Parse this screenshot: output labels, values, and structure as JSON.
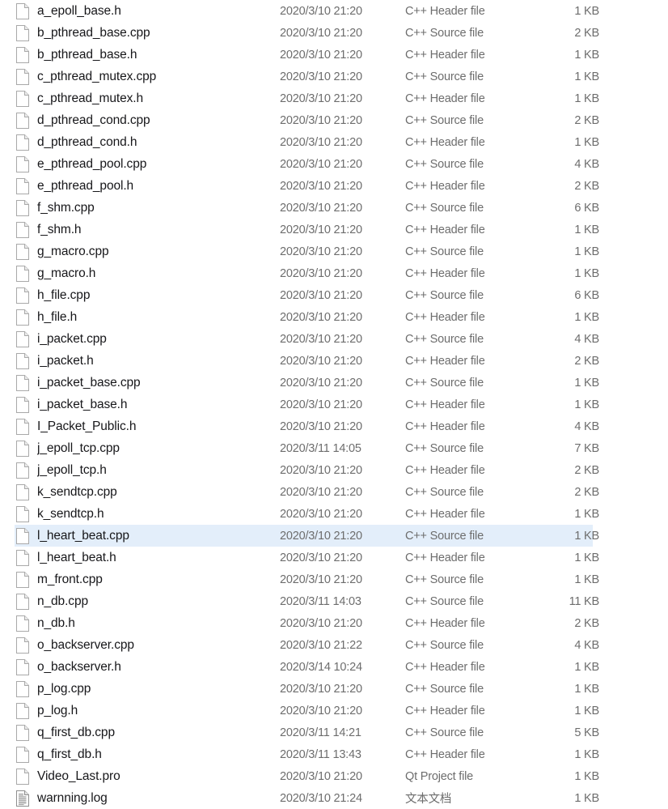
{
  "view": {
    "kind": "file-explorer-list",
    "columns": [
      "Name",
      "Date modified",
      "Type",
      "Size"
    ],
    "selection_color": "#e3eefa",
    "name_color": "#17171a",
    "meta_color": "#6d6d6d"
  },
  "files": [
    {
      "icon": "blank-file-icon",
      "name": "a_epoll_base.h",
      "date": "2020/3/10 21:20",
      "type": "C++ Header file",
      "size": "1 KB",
      "selected": false
    },
    {
      "icon": "blank-file-icon",
      "name": "b_pthread_base.cpp",
      "date": "2020/3/10 21:20",
      "type": "C++ Source file",
      "size": "2 KB",
      "selected": false
    },
    {
      "icon": "blank-file-icon",
      "name": "b_pthread_base.h",
      "date": "2020/3/10 21:20",
      "type": "C++ Header file",
      "size": "1 KB",
      "selected": false
    },
    {
      "icon": "blank-file-icon",
      "name": "c_pthread_mutex.cpp",
      "date": "2020/3/10 21:20",
      "type": "C++ Source file",
      "size": "1 KB",
      "selected": false
    },
    {
      "icon": "blank-file-icon",
      "name": "c_pthread_mutex.h",
      "date": "2020/3/10 21:20",
      "type": "C++ Header file",
      "size": "1 KB",
      "selected": false
    },
    {
      "icon": "blank-file-icon",
      "name": "d_pthread_cond.cpp",
      "date": "2020/3/10 21:20",
      "type": "C++ Source file",
      "size": "2 KB",
      "selected": false
    },
    {
      "icon": "blank-file-icon",
      "name": "d_pthread_cond.h",
      "date": "2020/3/10 21:20",
      "type": "C++ Header file",
      "size": "1 KB",
      "selected": false
    },
    {
      "icon": "blank-file-icon",
      "name": "e_pthread_pool.cpp",
      "date": "2020/3/10 21:20",
      "type": "C++ Source file",
      "size": "4 KB",
      "selected": false
    },
    {
      "icon": "blank-file-icon",
      "name": "e_pthread_pool.h",
      "date": "2020/3/10 21:20",
      "type": "C++ Header file",
      "size": "2 KB",
      "selected": false
    },
    {
      "icon": "blank-file-icon",
      "name": "f_shm.cpp",
      "date": "2020/3/10 21:20",
      "type": "C++ Source file",
      "size": "6 KB",
      "selected": false
    },
    {
      "icon": "blank-file-icon",
      "name": "f_shm.h",
      "date": "2020/3/10 21:20",
      "type": "C++ Header file",
      "size": "1 KB",
      "selected": false
    },
    {
      "icon": "blank-file-icon",
      "name": "g_macro.cpp",
      "date": "2020/3/10 21:20",
      "type": "C++ Source file",
      "size": "1 KB",
      "selected": false
    },
    {
      "icon": "blank-file-icon",
      "name": "g_macro.h",
      "date": "2020/3/10 21:20",
      "type": "C++ Header file",
      "size": "1 KB",
      "selected": false
    },
    {
      "icon": "blank-file-icon",
      "name": "h_file.cpp",
      "date": "2020/3/10 21:20",
      "type": "C++ Source file",
      "size": "6 KB",
      "selected": false
    },
    {
      "icon": "blank-file-icon",
      "name": "h_file.h",
      "date": "2020/3/10 21:20",
      "type": "C++ Header file",
      "size": "1 KB",
      "selected": false
    },
    {
      "icon": "blank-file-icon",
      "name": "i_packet.cpp",
      "date": "2020/3/10 21:20",
      "type": "C++ Source file",
      "size": "4 KB",
      "selected": false
    },
    {
      "icon": "blank-file-icon",
      "name": "i_packet.h",
      "date": "2020/3/10 21:20",
      "type": "C++ Header file",
      "size": "2 KB",
      "selected": false
    },
    {
      "icon": "blank-file-icon",
      "name": "i_packet_base.cpp",
      "date": "2020/3/10 21:20",
      "type": "C++ Source file",
      "size": "1 KB",
      "selected": false
    },
    {
      "icon": "blank-file-icon",
      "name": "i_packet_base.h",
      "date": "2020/3/10 21:20",
      "type": "C++ Header file",
      "size": "1 KB",
      "selected": false
    },
    {
      "icon": "blank-file-icon",
      "name": "I_Packet_Public.h",
      "date": "2020/3/10 21:20",
      "type": "C++ Header file",
      "size": "4 KB",
      "selected": false
    },
    {
      "icon": "blank-file-icon",
      "name": "j_epoll_tcp.cpp",
      "date": "2020/3/11 14:05",
      "type": "C++ Source file",
      "size": "7 KB",
      "selected": false
    },
    {
      "icon": "blank-file-icon",
      "name": "j_epoll_tcp.h",
      "date": "2020/3/10 21:20",
      "type": "C++ Header file",
      "size": "2 KB",
      "selected": false
    },
    {
      "icon": "blank-file-icon",
      "name": "k_sendtcp.cpp",
      "date": "2020/3/10 21:20",
      "type": "C++ Source file",
      "size": "2 KB",
      "selected": false
    },
    {
      "icon": "blank-file-icon",
      "name": "k_sendtcp.h",
      "date": "2020/3/10 21:20",
      "type": "C++ Header file",
      "size": "1 KB",
      "selected": false
    },
    {
      "icon": "blank-file-icon",
      "name": "l_heart_beat.cpp",
      "date": "2020/3/10 21:20",
      "type": "C++ Source file",
      "size": "1 KB",
      "selected": true
    },
    {
      "icon": "blank-file-icon",
      "name": "l_heart_beat.h",
      "date": "2020/3/10 21:20",
      "type": "C++ Header file",
      "size": "1 KB",
      "selected": false
    },
    {
      "icon": "blank-file-icon",
      "name": "m_front.cpp",
      "date": "2020/3/10 21:20",
      "type": "C++ Source file",
      "size": "1 KB",
      "selected": false
    },
    {
      "icon": "blank-file-icon",
      "name": "n_db.cpp",
      "date": "2020/3/11 14:03",
      "type": "C++ Source file",
      "size": "11 KB",
      "selected": false
    },
    {
      "icon": "blank-file-icon",
      "name": "n_db.h",
      "date": "2020/3/10 21:20",
      "type": "C++ Header file",
      "size": "2 KB",
      "selected": false
    },
    {
      "icon": "blank-file-icon",
      "name": "o_backserver.cpp",
      "date": "2020/3/10 21:22",
      "type": "C++ Source file",
      "size": "4 KB",
      "selected": false
    },
    {
      "icon": "blank-file-icon",
      "name": "o_backserver.h",
      "date": "2020/3/14 10:24",
      "type": "C++ Header file",
      "size": "1 KB",
      "selected": false
    },
    {
      "icon": "blank-file-icon",
      "name": "p_log.cpp",
      "date": "2020/3/10 21:20",
      "type": "C++ Source file",
      "size": "1 KB",
      "selected": false
    },
    {
      "icon": "blank-file-icon",
      "name": "p_log.h",
      "date": "2020/3/10 21:20",
      "type": "C++ Header file",
      "size": "1 KB",
      "selected": false
    },
    {
      "icon": "blank-file-icon",
      "name": "q_first_db.cpp",
      "date": "2020/3/11 14:21",
      "type": "C++ Source file",
      "size": "5 KB",
      "selected": false
    },
    {
      "icon": "blank-file-icon",
      "name": "q_first_db.h",
      "date": "2020/3/11 13:43",
      "type": "C++ Header file",
      "size": "1 KB",
      "selected": false
    },
    {
      "icon": "blank-file-icon",
      "name": "Video_Last.pro",
      "date": "2020/3/10 21:20",
      "type": "Qt Project file",
      "size": "1 KB",
      "selected": false
    },
    {
      "icon": "text-file-icon",
      "name": "warnning.log",
      "date": "2020/3/10 21:24",
      "type": "文本文档",
      "size": "1 KB",
      "selected": false
    }
  ]
}
